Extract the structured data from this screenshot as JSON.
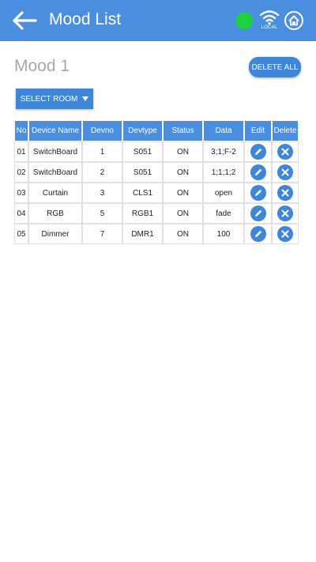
{
  "header": {
    "title": "Mood List",
    "wifi_label": "LOCAL",
    "status_color": "#1fd13f",
    "bar_color": "#4a8ee0"
  },
  "mood": {
    "name": "Mood 1"
  },
  "actions": {
    "delete_all_label": "DELETE ALL",
    "select_room_label": "SELECT ROOM"
  },
  "table": {
    "columns": [
      "No",
      "Device Name",
      "Devno",
      "Devtype",
      "Status",
      "Data",
      "Edit",
      "Delete"
    ],
    "rows": [
      {
        "no": "01",
        "device_name": "SwitchBoard",
        "devno": "1",
        "devtype": "S051",
        "status": "ON",
        "data": "3;1;F-2"
      },
      {
        "no": "02",
        "device_name": "SwitchBoard",
        "devno": "2",
        "devtype": "S051",
        "status": "ON",
        "data": "1;1;1;2"
      },
      {
        "no": "03",
        "device_name": "Curtain",
        "devno": "3",
        "devtype": "CLS1",
        "status": "ON",
        "data": "open"
      },
      {
        "no": "04",
        "device_name": "RGB",
        "devno": "5",
        "devtype": "RGB1",
        "status": "ON",
        "data": "fade"
      },
      {
        "no": "05",
        "device_name": "Dimmer",
        "devno": "7",
        "devtype": "DMR1",
        "status": "ON",
        "data": "100"
      }
    ]
  }
}
